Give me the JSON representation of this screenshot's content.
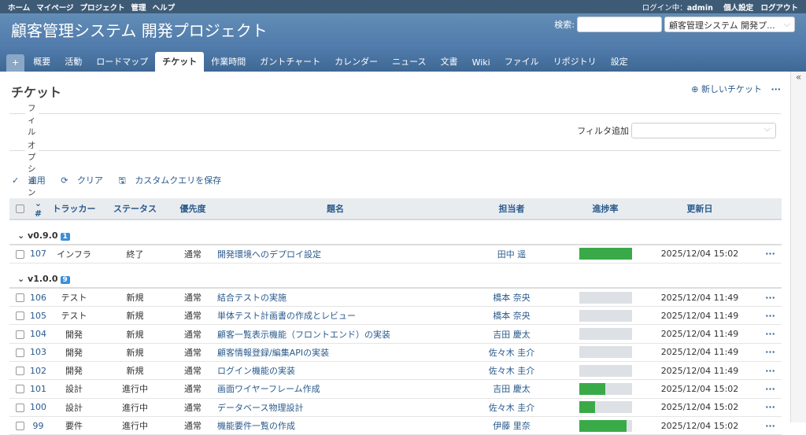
{
  "top_menu": {
    "left": [
      "ホーム",
      "マイページ",
      "プロジェクト",
      "管理",
      "ヘルプ"
    ],
    "logged_in_label": "ログイン中：",
    "user": "admin",
    "my_account": "個人設定",
    "logout": "ログアウト"
  },
  "header": {
    "title": "顧客管理システム 開発プロジェクト",
    "search_label": "検索:",
    "search_value": "",
    "project_select": "顧客管理システム 開発プ..."
  },
  "tabs": [
    "+",
    "概要",
    "活動",
    "ロードマップ",
    "チケット",
    "作業時間",
    "ガントチャート",
    "カレンダー",
    "ニュース",
    "文書",
    "Wiki",
    "ファイル",
    "リポジトリ",
    "設定"
  ],
  "selected_tab": "チケット",
  "page": {
    "title": "チケット",
    "new_issue": "新しいチケット",
    "more": "···",
    "filter_legend": "フィルタ",
    "options_legend": "オプション",
    "add_filter_label": "フィルタ追加",
    "add_filter_value": "",
    "apply": "適用",
    "clear": "クリア",
    "save_query": "カスタムクエリを保存"
  },
  "table": {
    "columns": [
      "#",
      "トラッカー",
      "ステータス",
      "優先度",
      "題名",
      "担当者",
      "進捗率",
      "更新日"
    ],
    "groups": [
      {
        "name": "v0.9.0",
        "count": "1",
        "rows": [
          {
            "id": "107",
            "tracker": "インフラ",
            "status": "終了",
            "priority": "通常",
            "subject": "開発環境へのデプロイ設定",
            "assignee": "田中 遥",
            "progress": 100,
            "updated": "2025/12/04 15:02"
          }
        ]
      },
      {
        "name": "v1.0.0",
        "count": "9",
        "rows": [
          {
            "id": "106",
            "tracker": "テスト",
            "status": "新規",
            "priority": "通常",
            "subject": "結合テストの実施",
            "assignee": "橋本 奈央",
            "progress": 0,
            "updated": "2025/12/04 11:49"
          },
          {
            "id": "105",
            "tracker": "テスト",
            "status": "新規",
            "priority": "通常",
            "subject": "単体テスト計画書の作成とレビュー",
            "assignee": "橋本 奈央",
            "progress": 0,
            "updated": "2025/12/04 11:49"
          },
          {
            "id": "104",
            "tracker": "開発",
            "status": "新規",
            "priority": "通常",
            "subject": "顧客一覧表示機能（フロントエンド）の実装",
            "assignee": "吉田 慶太",
            "progress": 0,
            "updated": "2025/12/04 11:49"
          },
          {
            "id": "103",
            "tracker": "開発",
            "status": "新規",
            "priority": "通常",
            "subject": "顧客情報登録/編集APIの実装",
            "assignee": "佐々木 圭介",
            "progress": 0,
            "updated": "2025/12/04 11:49"
          },
          {
            "id": "102",
            "tracker": "開発",
            "status": "新規",
            "priority": "通常",
            "subject": "ログイン機能の実装",
            "assignee": "佐々木 圭介",
            "progress": 0,
            "updated": "2025/12/04 11:49"
          },
          {
            "id": "101",
            "tracker": "設計",
            "status": "進行中",
            "priority": "通常",
            "subject": "画面ワイヤーフレーム作成",
            "assignee": "吉田 慶太",
            "progress": 50,
            "updated": "2025/12/04 15:02"
          },
          {
            "id": "100",
            "tracker": "設計",
            "status": "進行中",
            "priority": "通常",
            "subject": "データベース物理設計",
            "assignee": "佐々木 圭介",
            "progress": 30,
            "updated": "2025/12/04 15:02"
          },
          {
            "id": "99",
            "tracker": "要件",
            "status": "進行中",
            "priority": "通常",
            "subject": "機能要件一覧の作成",
            "assignee": "伊藤 里奈",
            "progress": 90,
            "updated": "2025/12/04 15:02"
          }
        ]
      }
    ]
  },
  "colors": {
    "header": "#507aaa",
    "topbar": "#3e5b76",
    "link": "#2a5a8c",
    "progress": "#3aaa48"
  }
}
